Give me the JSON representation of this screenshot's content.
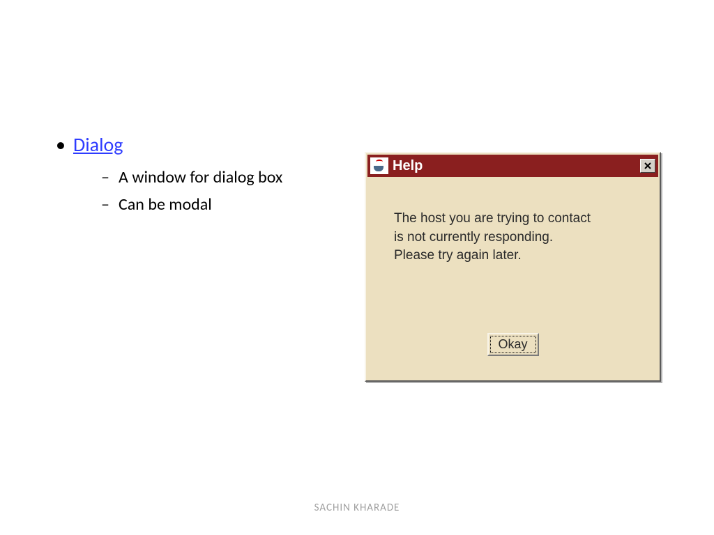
{
  "bullet": {
    "title": "Dialog",
    "subitems": [
      "A window for dialog box",
      "Can be modal"
    ]
  },
  "dialog": {
    "title": "Help",
    "message_line1": "The host you are trying to contact",
    "message_line2": "is not currently responding.",
    "message_line3": "Please try again later.",
    "ok_label": "Okay",
    "close_label": "✕"
  },
  "footer": "SACHIN KHARADE"
}
